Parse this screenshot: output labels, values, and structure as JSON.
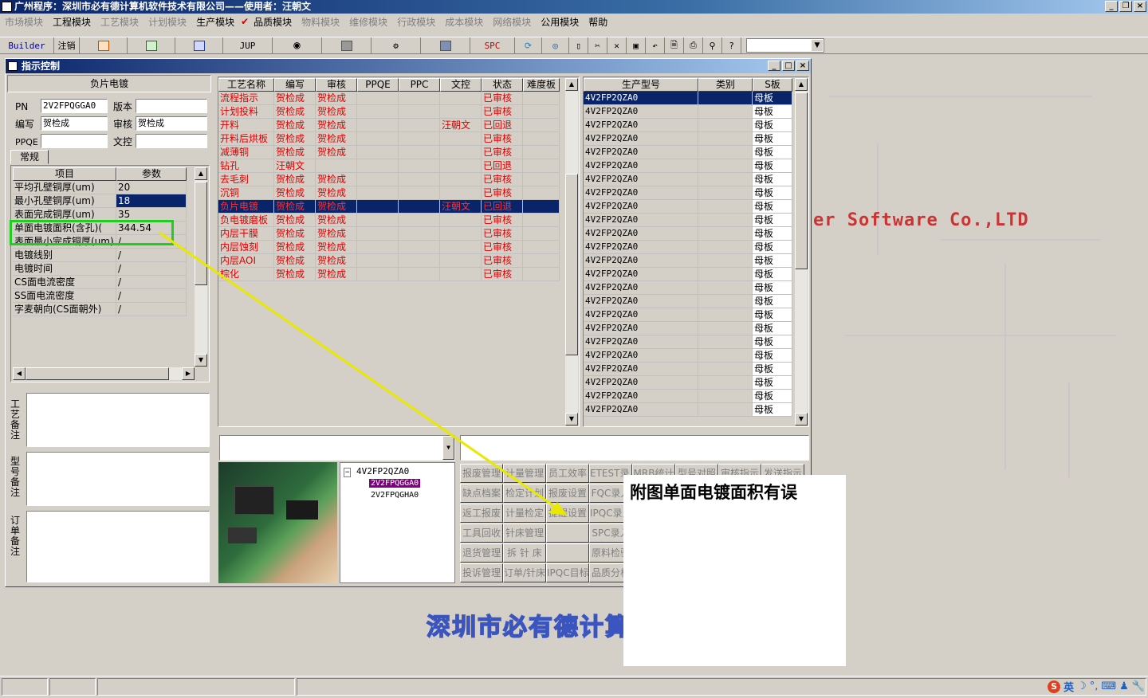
{
  "app": {
    "title": "广州程序：深圳市必有德计算机软件技术有限公司——使用者：汪朝文"
  },
  "menu": [
    {
      "label": "市场模块",
      "enabled": false
    },
    {
      "label": "工程模块",
      "enabled": true
    },
    {
      "label": "工艺模块",
      "enabled": false
    },
    {
      "label": "计划模块",
      "enabled": false
    },
    {
      "label": "生产模块",
      "enabled": true
    },
    {
      "label": "品质模块",
      "enabled": true
    },
    {
      "label": "物料模块",
      "enabled": false
    },
    {
      "label": "维修模块",
      "enabled": false
    },
    {
      "label": "行政模块",
      "enabled": false
    },
    {
      "label": "成本模块",
      "enabled": false
    },
    {
      "label": "网络模块",
      "enabled": false
    },
    {
      "label": "公用模块",
      "enabled": true
    },
    {
      "label": "帮助",
      "enabled": true
    }
  ],
  "toolbar": {
    "builder": "Builder",
    "logout": "注销",
    "jup": "JUP",
    "spc": "SPC"
  },
  "window": {
    "title": "指示控制"
  },
  "left": {
    "section_title": "负片电镀",
    "pn_label": "PN",
    "pn_value": "2V2FPQGGA0",
    "version_label": "版本",
    "version_value": "",
    "author_label": "编写",
    "author_value": "贺检成",
    "review_label": "审核",
    "review_value": "贺检成",
    "ppqe_label": "PPQE",
    "ppqe_value": "",
    "wenkong_label": "文控",
    "wenkong_value": "",
    "tab_general": "常规",
    "params_header": [
      "项目",
      "参数"
    ],
    "params": [
      [
        "平均孔壁铜厚(um)",
        "20"
      ],
      [
        "最小孔壁铜厚(um)",
        "18"
      ],
      [
        "表面完成铜厚(um)",
        "35"
      ],
      [
        "单面电镀面积(含孔)(",
        "344.54"
      ],
      [
        "表面最小完成铜厚(um)",
        "/"
      ],
      [
        "电镀线别",
        "/"
      ],
      [
        "电镀时间",
        "/"
      ],
      [
        "CS面电流密度",
        "/"
      ],
      [
        "SS面电流密度",
        "/"
      ],
      [
        "字麦朝向(CS面朝外)",
        "/"
      ]
    ],
    "remark_process": "工艺备注",
    "remark_model": "型号备注",
    "remark_order": "订单备注"
  },
  "process_grid": {
    "headers": [
      "工艺名称",
      "编写",
      "审核",
      "PPQE",
      "PPC",
      "文控",
      "状态",
      "难度板"
    ],
    "rows": [
      [
        "流程指示",
        "贺检成",
        "贺检成",
        "",
        "",
        "",
        "已审核",
        ""
      ],
      [
        "计划投料",
        "贺检成",
        "贺检成",
        "",
        "",
        "",
        "已审核",
        ""
      ],
      [
        "开料",
        "贺检成",
        "贺检成",
        "",
        "",
        "汪朝文",
        "已回退",
        ""
      ],
      [
        "开料后烘板",
        "贺检成",
        "贺检成",
        "",
        "",
        "",
        "已审核",
        ""
      ],
      [
        "减薄铜",
        "贺检成",
        "贺检成",
        "",
        "",
        "",
        "已审核",
        ""
      ],
      [
        "钻孔",
        "汪朝文",
        "",
        "",
        "",
        "",
        "已回退",
        ""
      ],
      [
        "去毛刺",
        "贺检成",
        "贺检成",
        "",
        "",
        "",
        "已审核",
        ""
      ],
      [
        "沉铜",
        "贺检成",
        "贺检成",
        "",
        "",
        "",
        "已审核",
        ""
      ],
      [
        "负片电镀",
        "贺检成",
        "贺检成",
        "",
        "",
        "汪朝文",
        "已回退",
        ""
      ],
      [
        "负电镀磨板",
        "贺检成",
        "贺检成",
        "",
        "",
        "",
        "已审核",
        ""
      ],
      [
        "内层干膜",
        "贺检成",
        "贺检成",
        "",
        "",
        "",
        "已审核",
        ""
      ],
      [
        "内层蚀刻",
        "贺检成",
        "贺检成",
        "",
        "",
        "",
        "已审核",
        ""
      ],
      [
        "内层AOI",
        "贺检成",
        "贺检成",
        "",
        "",
        "",
        "已审核",
        ""
      ],
      [
        "棕化",
        "贺检成",
        "贺检成",
        "",
        "",
        "",
        "已审核",
        ""
      ]
    ],
    "selected_row": 8
  },
  "model_grid": {
    "headers": [
      "生产型号",
      "类别",
      "S板"
    ],
    "model": "4V2FP2QZA0",
    "category": "母板",
    "row_count": 24
  },
  "tree": {
    "root": "4V2FP2QZA0",
    "children": [
      "2V2FPQGGA0",
      "2V2FPQGHA0"
    ]
  },
  "buttons": [
    [
      "报废管理",
      "计量管理",
      "员工效率",
      "ETEST录入",
      "MRB统计",
      "型号对照",
      "审核指示",
      "发送指示"
    ],
    [
      "缺点档案",
      "检定计划",
      "报废设置",
      "FQC录入"
    ],
    [
      "返工报废",
      "计量检定",
      "提醒设置",
      "IPQC录入"
    ],
    [
      "工具回收",
      "针床管理",
      "",
      "SPC录入"
    ],
    [
      "退货管理",
      "拆 针 床",
      "",
      "原料检验"
    ],
    [
      "投诉管理",
      "订单/针床",
      "IPQC目标",
      "品质分析"
    ]
  ],
  "overlay": {
    "note": "附图单面电镀面积有误"
  },
  "background": {
    "ltd": "er Software Co.,LTD",
    "company": "深圳市必有德计算机软件有限公司"
  },
  "ime": {
    "lang": "英"
  }
}
